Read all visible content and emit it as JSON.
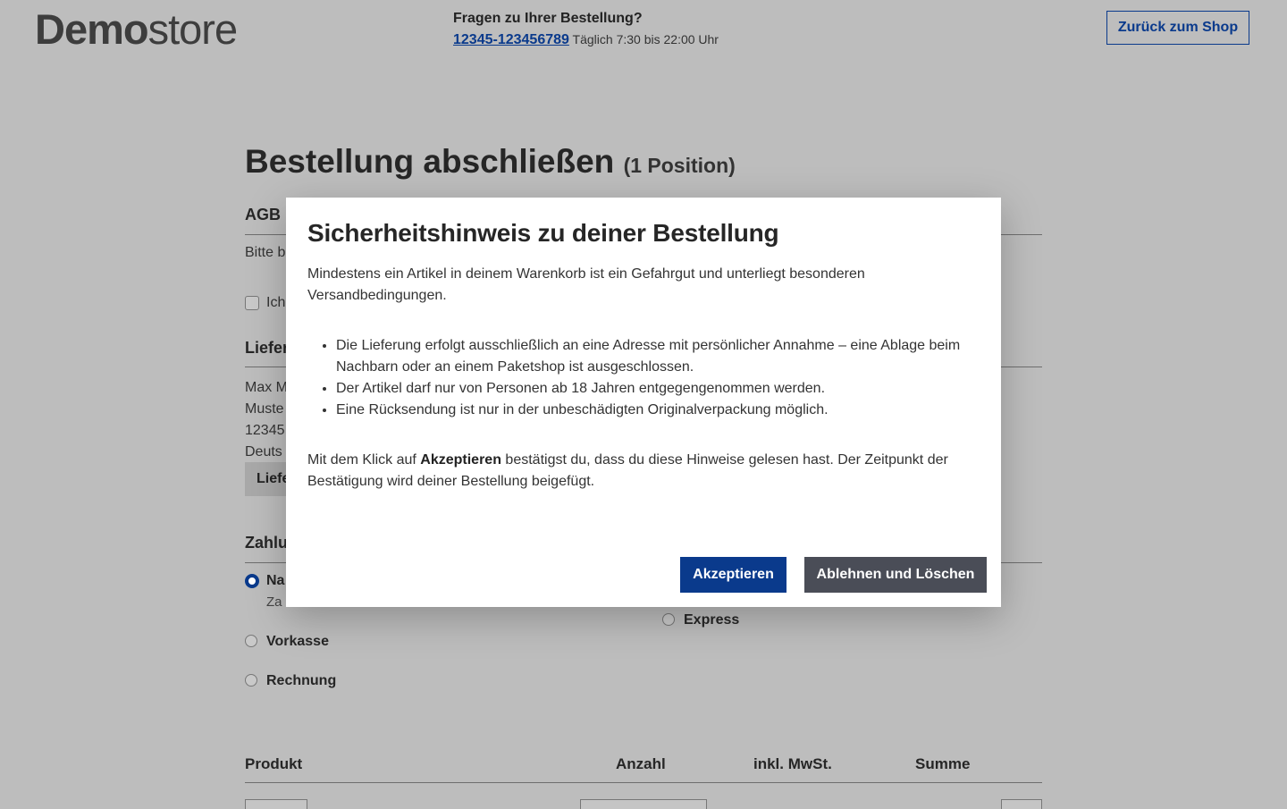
{
  "header": {
    "logo_bold": "Demo",
    "logo_light": "store",
    "contact_question": "Fragen zu Ihrer Bestellung?",
    "phone": "12345-123456789",
    "hours": "Täglich 7:30 bis 22:00 Uhr",
    "back_button": "Zurück zum Shop"
  },
  "page": {
    "title": "Bestellung abschließen",
    "title_count": "(1 Position)",
    "agb_title": "AGB u",
    "agb_text": "Bitte b",
    "agb_checkbox_label": "Ich",
    "delivery_title": "Liefer",
    "address_lines": [
      "Max M",
      "Muste",
      "12345",
      "Deuts"
    ],
    "address_button": "Liefe",
    "payment_title": "Zahlu",
    "payment_options": [
      {
        "label": "Na",
        "selected": true
      },
      {
        "label": "Vorkasse",
        "selected": false
      },
      {
        "label": "Rechnung",
        "selected": false
      }
    ],
    "payment_sub": "Za",
    "shipping_option": "Express",
    "table_headers": {
      "product": "Produkt",
      "quantity": "Anzahl",
      "vat": "inkl. MwSt.",
      "sum": "Summe"
    }
  },
  "modal": {
    "title": "Sicherheitshinweis zu deiner Bestellung",
    "intro": "Mindestens ein Artikel in deinem Warenkorb ist ein Gefahrgut und unterliegt besonderen Versandbedingungen.",
    "bullets": [
      "Die Lieferung erfolgt ausschließlich an eine Adresse mit persönlicher Annahme – eine Ablage beim Nachbarn oder an einem Paketshop ist ausgeschlossen.",
      "Der Artikel darf nur von Personen ab 18 Jahren entgegengenommen werden.",
      "Eine Rücksendung ist nur in der unbeschädigten Originalverpackung möglich."
    ],
    "confirm_prefix": "Mit dem Klick auf",
    "confirm_bold": "Akzeptieren",
    "confirm_suffix": "bestätigst du, dass du diese Hinweise gelesen hast. Der Zeitpunkt der Bestätigung wird deiner Bestellung beigefügt.",
    "accept_button": "Akzeptieren",
    "decline_button": "Ablehnen und Löschen"
  },
  "colors": {
    "primary": "#0a3a8c",
    "secondary_button": "#4a4d57",
    "backdrop": "#bdbdbd"
  }
}
